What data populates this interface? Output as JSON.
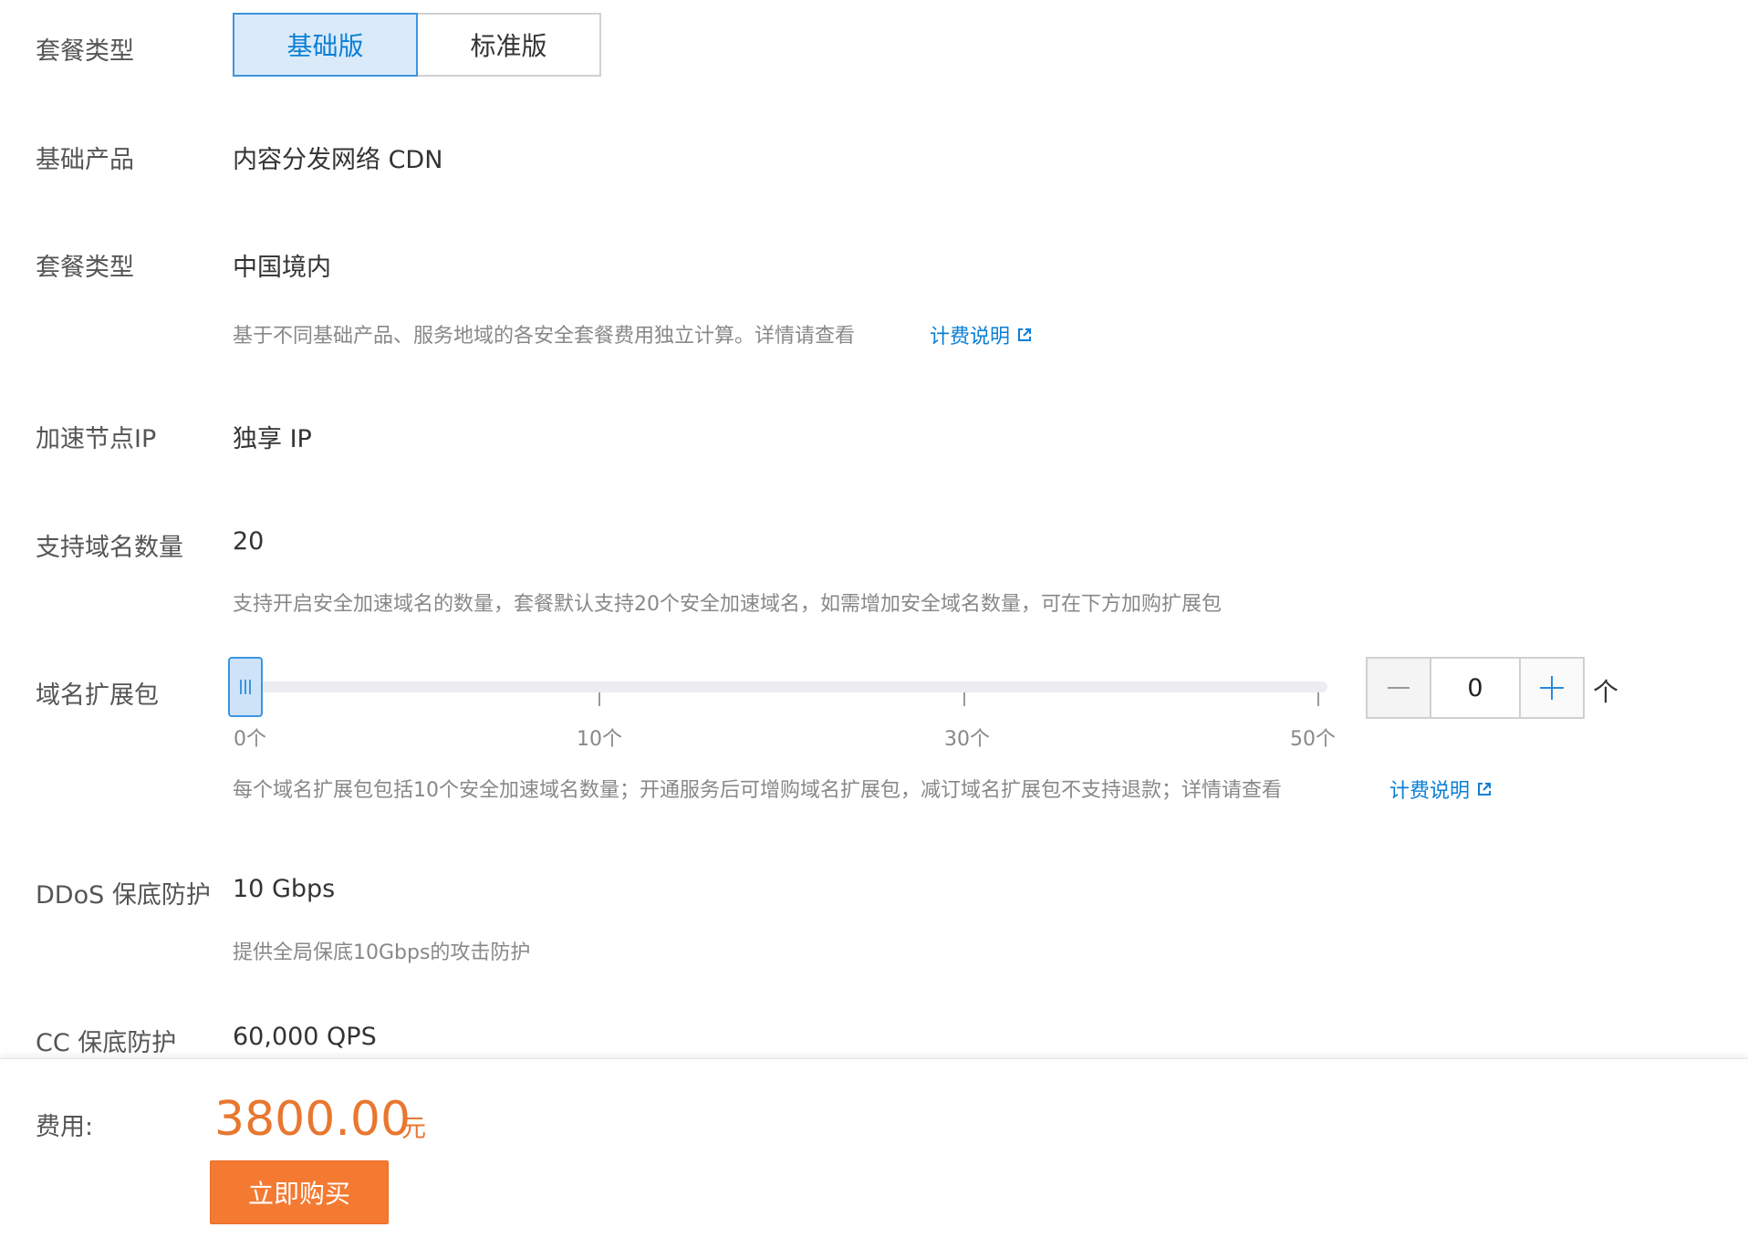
{
  "package_type": {
    "label": "套餐类型",
    "options": [
      "基础版",
      "标准版"
    ],
    "selected": "基础版"
  },
  "base_product": {
    "label": "基础产品",
    "value": "内容分发网络 CDN"
  },
  "region": {
    "label": "套餐类型",
    "value": "中国境内",
    "desc": "基于不同基础产品、服务地域的各安全套餐费用独立计算。详情请查看",
    "link": "计费说明"
  },
  "node_ip": {
    "label": "加速节点IP",
    "value": "独享 IP"
  },
  "domain_count": {
    "label": "支持域名数量",
    "value": "20",
    "desc": "支持开启安全加速域名的数量，套餐默认支持20个安全加速域名，如需增加安全域名数量，可在下方加购扩展包"
  },
  "domain_pack": {
    "label": "域名扩展包",
    "slider_value": 0,
    "slider_min": 0,
    "slider_max": 50,
    "ticks": [
      "0个",
      "10个",
      "30个",
      "50个"
    ],
    "quantity": "0",
    "unit": "个",
    "desc": "每个域名扩展包包括10个安全加速域名数量；开通服务后可增购域名扩展包，减订域名扩展包不支持退款；详情请查看",
    "link": "计费说明"
  },
  "ddos": {
    "label": "DDoS 保底防护",
    "value": "10 Gbps",
    "desc": "提供全局保底10Gbps的攻击防护"
  },
  "cc": {
    "label": "CC 保底防护",
    "value": "60,000 QPS"
  },
  "footer": {
    "fee_label": "费用:",
    "price": "3800.00",
    "currency": "元",
    "buy_label": "立即购买"
  },
  "colors": {
    "accent_blue": "#0a7fd6",
    "price_orange": "#e8772f",
    "buy_button": "#f47a32"
  }
}
